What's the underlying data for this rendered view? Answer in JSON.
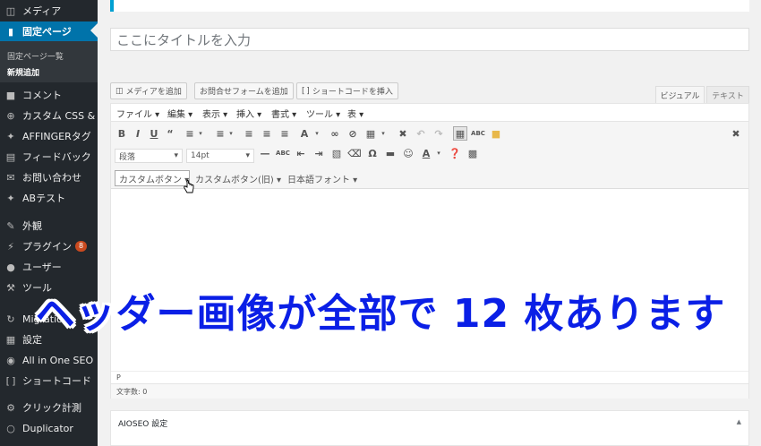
{
  "sidebar": {
    "items": [
      {
        "label": "メディア",
        "icon": "media-icon"
      },
      {
        "label": "固定ページ",
        "icon": "pages-icon",
        "current": true
      },
      {
        "label": "コメント",
        "icon": "comments-icon"
      },
      {
        "label": "カスタム CSS & JS",
        "icon": "plus-circle-icon"
      },
      {
        "label": "AFFINGERタグ",
        "icon": "pin-icon"
      },
      {
        "label": "フィードバック",
        "icon": "feedback-icon"
      },
      {
        "label": "お問い合わせ",
        "icon": "mail-icon"
      },
      {
        "label": "ABテスト",
        "icon": "pin-icon"
      },
      {
        "label": "外観",
        "icon": "brush-icon"
      },
      {
        "label": "プラグイン",
        "icon": "plugin-icon",
        "badge": "8"
      },
      {
        "label": "ユーザー",
        "icon": "user-icon"
      },
      {
        "label": "ツール",
        "icon": "wrench-icon"
      },
      {
        "label": "Migratio",
        "icon": "refresh-icon"
      },
      {
        "label": "設定",
        "icon": "settings-icon"
      },
      {
        "label": "All in One SEO",
        "icon": "seo-icon"
      },
      {
        "label": "ショートコード",
        "icon": "brackets-icon"
      },
      {
        "label": "クリック計測",
        "icon": "gear-icon"
      },
      {
        "label": "Duplicator",
        "icon": "duplicator-icon"
      }
    ],
    "submenu": [
      "固定ページ一覧",
      "新規追加"
    ]
  },
  "editor": {
    "title_placeholder": "ここにタイトルを入力",
    "media_buttons": [
      "メディアを追加",
      "お問合せフォームを追加",
      "ショートコードを挿入"
    ],
    "tabs": [
      "ビジュアル",
      "テキスト"
    ],
    "menus": [
      "ファイル ▾",
      "編集 ▾",
      "表示 ▾",
      "挿入 ▾",
      "書式 ▾",
      "ツール ▾",
      "表 ▾"
    ],
    "format_select": "段落",
    "size_select": "14pt",
    "dropdowns": [
      "カスタムボタン ▾",
      "カスタムボタン(旧) ▾",
      "日本語フォント ▾"
    ],
    "path": "P",
    "word_count": "文字数: 0"
  },
  "aioseo": {
    "title": "AIOSEO 設定"
  },
  "overlay_caption": "ヘッダー画像が全部で 12 枚あります"
}
